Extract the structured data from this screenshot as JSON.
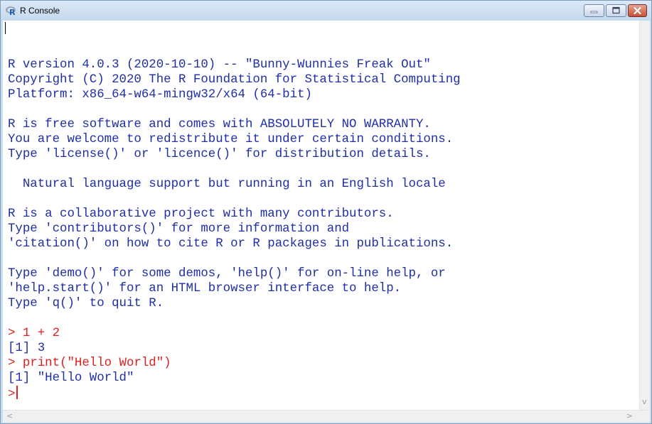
{
  "window": {
    "title": "R Console",
    "icon": "r-logo-icon",
    "buttons": [
      "minimize-icon",
      "maximize-icon",
      "close-icon"
    ]
  },
  "colors": {
    "output": "#1f2fa8",
    "command": "#e02020",
    "titlebar": "#c9dcef"
  },
  "console": {
    "lines": [
      {
        "type": "out",
        "text": ""
      },
      {
        "type": "out",
        "text": "R version 4.0.3 (2020-10-10) -- \"Bunny-Wunnies Freak Out\""
      },
      {
        "type": "out",
        "text": "Copyright (C) 2020 The R Foundation for Statistical Computing"
      },
      {
        "type": "out",
        "text": "Platform: x86_64-w64-mingw32/x64 (64-bit)"
      },
      {
        "type": "out",
        "text": ""
      },
      {
        "type": "out",
        "text": "R is free software and comes with ABSOLUTELY NO WARRANTY."
      },
      {
        "type": "out",
        "text": "You are welcome to redistribute it under certain conditions."
      },
      {
        "type": "out",
        "text": "Type 'license()' or 'licence()' for distribution details."
      },
      {
        "type": "out",
        "text": ""
      },
      {
        "type": "out",
        "text": "  Natural language support but running in an English locale"
      },
      {
        "type": "out",
        "text": ""
      },
      {
        "type": "out",
        "text": "R is a collaborative project with many contributors."
      },
      {
        "type": "out",
        "text": "Type 'contributors()' for more information and"
      },
      {
        "type": "out",
        "text": "'citation()' on how to cite R or R packages in publications."
      },
      {
        "type": "out",
        "text": ""
      },
      {
        "type": "out",
        "text": "Type 'demo()' for some demos, 'help()' for on-line help, or"
      },
      {
        "type": "out",
        "text": "'help.start()' for an HTML browser interface to help."
      },
      {
        "type": "out",
        "text": "Type 'q()' to quit R."
      },
      {
        "type": "out",
        "text": ""
      },
      {
        "type": "cmd",
        "text": "> 1 + 2"
      },
      {
        "type": "res",
        "text": "[1] 3"
      },
      {
        "type": "cmd",
        "text": "> print(\"Hello World\")"
      },
      {
        "type": "res",
        "text": "[1] \"Hello World\""
      }
    ],
    "prompt": ">"
  },
  "scrollbar": {
    "left_arrow": "<",
    "right_arrow": ">",
    "down_arrow": "v"
  }
}
